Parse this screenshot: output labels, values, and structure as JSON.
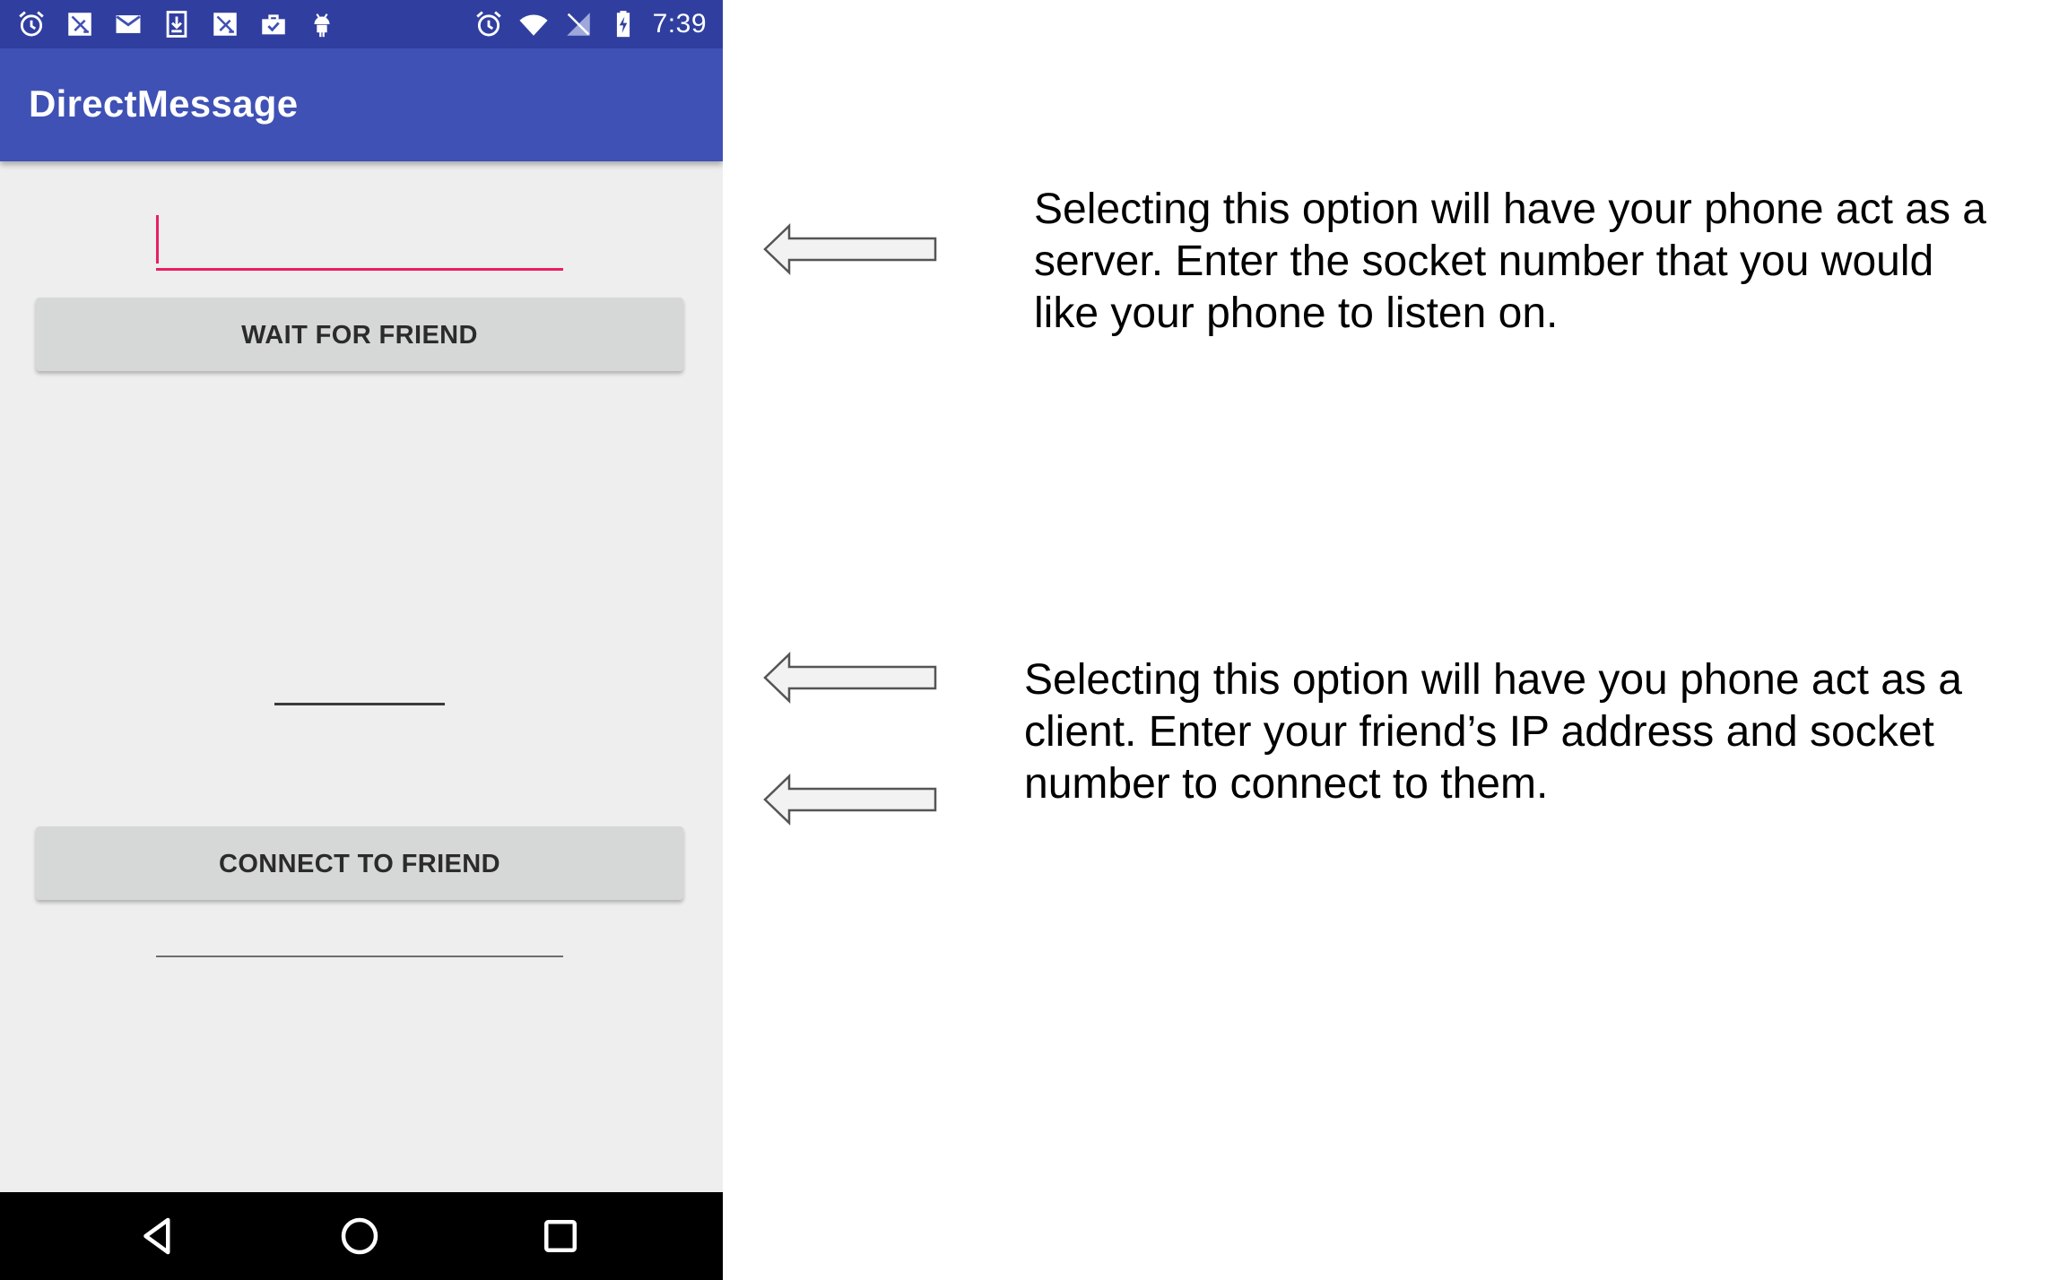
{
  "status_bar": {
    "left_icons": [
      "alarm-icon",
      "no-sim-notification-icon",
      "gmail-icon",
      "download-icon",
      "no-sim-notification-icon",
      "briefcase-check-icon",
      "android-icon"
    ],
    "right_icons": [
      "alarm-icon",
      "wifi-icon",
      "no-signal-icon",
      "battery-charging-icon"
    ],
    "time": "7:39"
  },
  "app_bar": {
    "title": "DirectMessage"
  },
  "server": {
    "socket_field_value": "",
    "wait_button_label": "WAIT FOR FRIEND"
  },
  "client": {
    "ip_field_value": "",
    "socket_field_value": "",
    "connect_button_label": "CONNECT TO FRIEND"
  },
  "nav_bar": {
    "icons": [
      "back-icon",
      "home-icon",
      "recents-icon"
    ]
  },
  "annotations": {
    "server_note_lines": [
      "Selecting this option will have your phone act as a",
      "server. Enter the socket number that you would",
      "like your phone to listen on."
    ],
    "client_note_lines": [
      "Selecting this option will have you phone act as a",
      "client. Enter your friend’s IP address and socket",
      "number to connect to them."
    ]
  },
  "colors": {
    "status_bar": "#303f9f",
    "app_bar": "#3f51b5",
    "accent": "#e91e63",
    "phone_background": "#eeeeee",
    "button": "#d6d7d7",
    "nav_bar": "#000000"
  }
}
